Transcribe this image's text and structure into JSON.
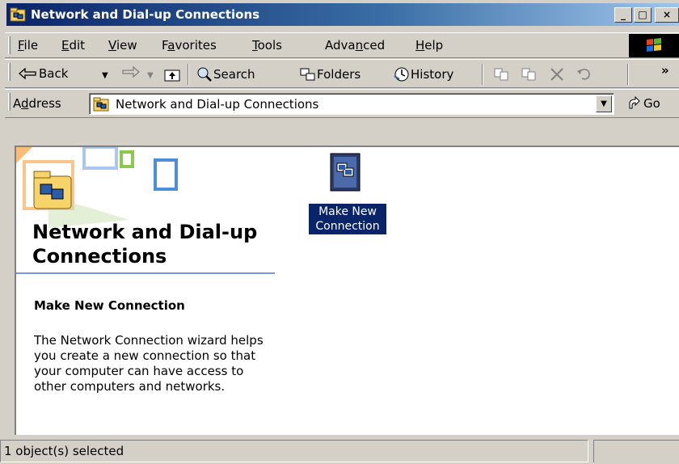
{
  "window": {
    "title": "Network and Dial-up Connections",
    "controls": {
      "minimize": "_",
      "maximize": "□",
      "close": "×"
    }
  },
  "menu": [
    {
      "label": "File",
      "accel": "F",
      "rest": "ile"
    },
    {
      "label": "Edit",
      "accel": "E",
      "rest": "dit"
    },
    {
      "label": "View",
      "accel": "V",
      "rest": "iew"
    },
    {
      "label": "Favorites",
      "pre": "F",
      "accel": "a",
      "rest": "vorites"
    },
    {
      "label": "Tools",
      "accel": "T",
      "rest": "ools"
    },
    {
      "label": "Advanced",
      "pre": "Adva",
      "accel": "n",
      "rest": "ced"
    },
    {
      "label": "Help",
      "accel": "H",
      "rest": "elp"
    }
  ],
  "toolbar": {
    "back": "Back",
    "search": "Search",
    "folders": "Folders",
    "history": "History",
    "more": "»"
  },
  "address": {
    "label_pre": "A",
    "label_accel": "d",
    "label_rest": "dress",
    "value": "Network and Dial-up Connections",
    "go": "Go"
  },
  "left_pane": {
    "title": "Network and Dial-up Connections",
    "subtitle": "Make New Connection",
    "description": "The Network Connection wizard helps you create a new connection so that your computer can have access to other computers and networks."
  },
  "items": [
    {
      "label": "Make New Connection",
      "selected": true,
      "icon": "network-connection-icon"
    }
  ],
  "status": {
    "text": "1 object(s) selected"
  },
  "colors": {
    "titlebar_start": "#0a246a",
    "titlebar_end": "#a6caf0",
    "chrome": "#d4d0c8",
    "selection": "#0a246a"
  }
}
